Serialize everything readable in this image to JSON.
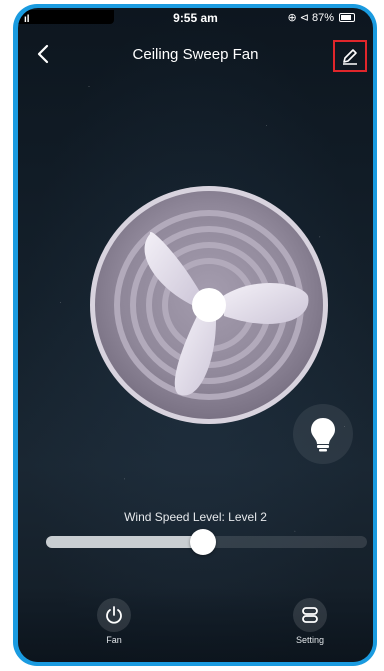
{
  "status_bar": {
    "signal": "ıl",
    "time": "9:55 am",
    "icons": "⊕ ⊲",
    "battery": "87%"
  },
  "header": {
    "back_icon": "chevron-left-icon",
    "title": "Ceiling Sweep Fan",
    "edit_icon": "pencil-icon"
  },
  "fan": {
    "icon": "fan-icon"
  },
  "light_button": {
    "icon": "bulb-icon"
  },
  "wind_speed": {
    "label": "Wind Speed Level: Level 2",
    "level_fraction": 0.49
  },
  "bottom_nav": {
    "items": [
      {
        "label": "Fan",
        "icon": "power-icon"
      },
      {
        "label": "Setting",
        "icon": "setting-icon"
      }
    ]
  },
  "colors": {
    "frame": "#1a9be0",
    "highlight_box": "#e0262b",
    "background": "#14202b"
  }
}
